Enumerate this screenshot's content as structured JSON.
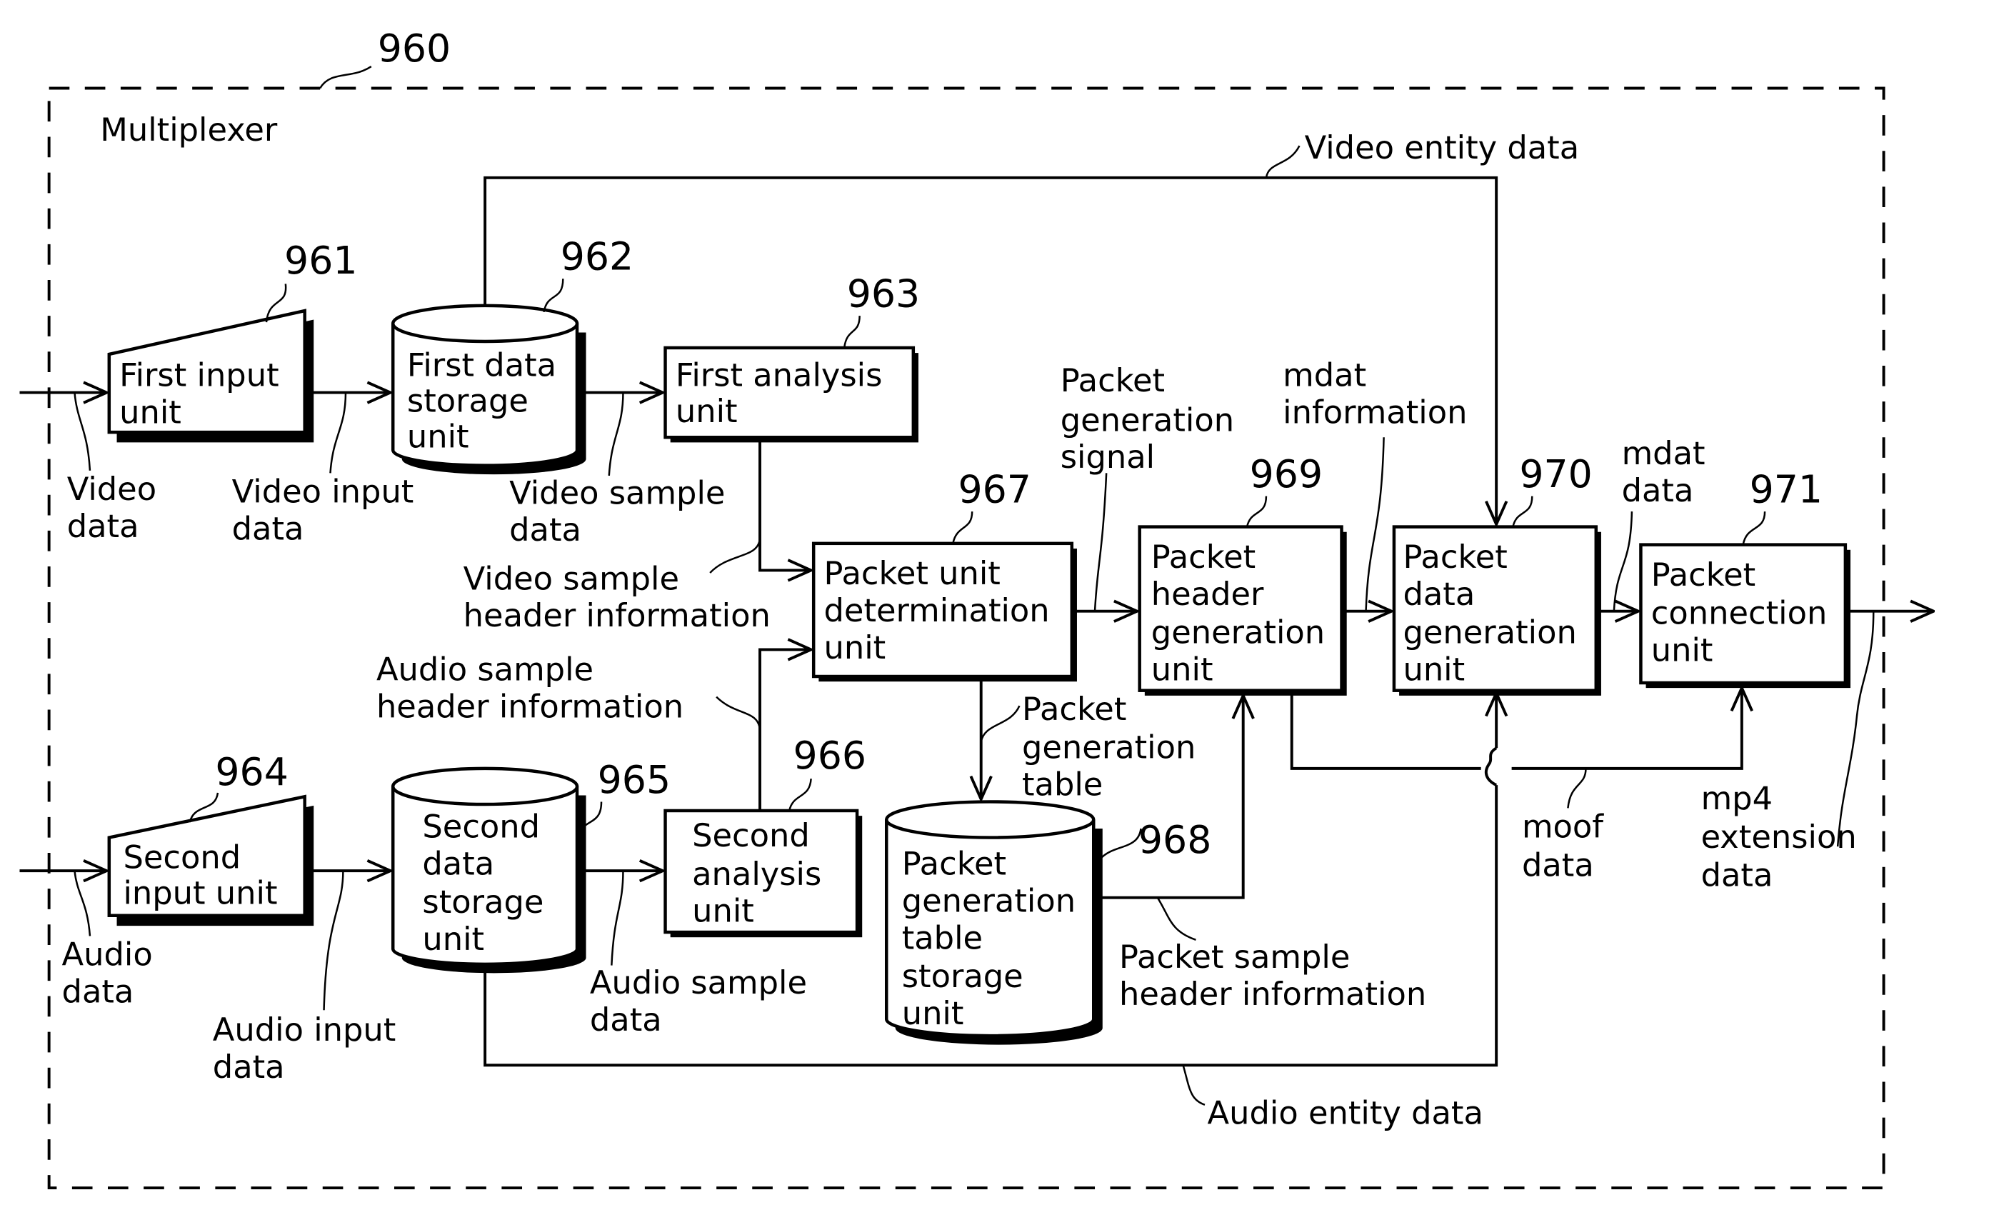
{
  "figure": {
    "container_label": "Multiplexer",
    "container_ref": "960"
  },
  "blocks": {
    "first_input": {
      "ref": "961",
      "lines": [
        "First input",
        "unit"
      ]
    },
    "first_storage": {
      "ref": "962",
      "lines": [
        "First data",
        "storage",
        "unit"
      ]
    },
    "first_analysis": {
      "ref": "963",
      "lines": [
        "First analysis",
        "unit"
      ]
    },
    "second_input": {
      "ref": "964",
      "lines": [
        "Second",
        "input unit"
      ]
    },
    "second_storage": {
      "ref": "965",
      "lines": [
        "Second",
        "data",
        "storage",
        "unit"
      ]
    },
    "second_analysis": {
      "ref": "966",
      "lines": [
        "Second",
        "analysis",
        "unit"
      ]
    },
    "packet_unit_determination": {
      "ref": "967",
      "lines": [
        "Packet unit",
        "determination",
        "unit"
      ]
    },
    "packet_table_storage": {
      "ref": "968",
      "lines": [
        "Packet",
        "generation",
        "table",
        "storage",
        "unit"
      ]
    },
    "packet_header_generation": {
      "ref": "969",
      "lines": [
        "Packet",
        "header",
        "generation",
        "unit"
      ]
    },
    "packet_data_generation": {
      "ref": "970",
      "lines": [
        "Packet",
        "data",
        "generation",
        "unit"
      ]
    },
    "packet_connection": {
      "ref": "971",
      "lines": [
        "Packet",
        "connection",
        "unit"
      ]
    }
  },
  "signals": {
    "video_data": [
      "Video",
      "data"
    ],
    "video_input_data": [
      "Video input",
      "data"
    ],
    "video_sample_data": [
      "Video sample",
      "data"
    ],
    "video_sample_header_info": [
      "Video sample",
      "header information"
    ],
    "audio_sample_header_info": [
      "Audio sample",
      "header information"
    ],
    "video_entity_data": [
      "Video entity data"
    ],
    "packet_generation_signal": [
      "Packet",
      "generation",
      "signal"
    ],
    "mdat_information": [
      "mdat",
      "information"
    ],
    "mdat_data": [
      "mdat",
      "data"
    ],
    "packet_generation_table": [
      "Packet",
      "generation",
      "table"
    ],
    "audio_data": [
      "Audio",
      "data"
    ],
    "audio_input_data": [
      "Audio input",
      "data"
    ],
    "audio_sample_data": [
      "Audio sample",
      "data"
    ],
    "packet_sample_header_info": [
      "Packet sample",
      "header information"
    ],
    "audio_entity_data": [
      "Audio entity data"
    ],
    "moof_data": [
      "moof",
      "data"
    ],
    "mp4_extension_data": [
      "mp4",
      "extension",
      "data"
    ]
  }
}
